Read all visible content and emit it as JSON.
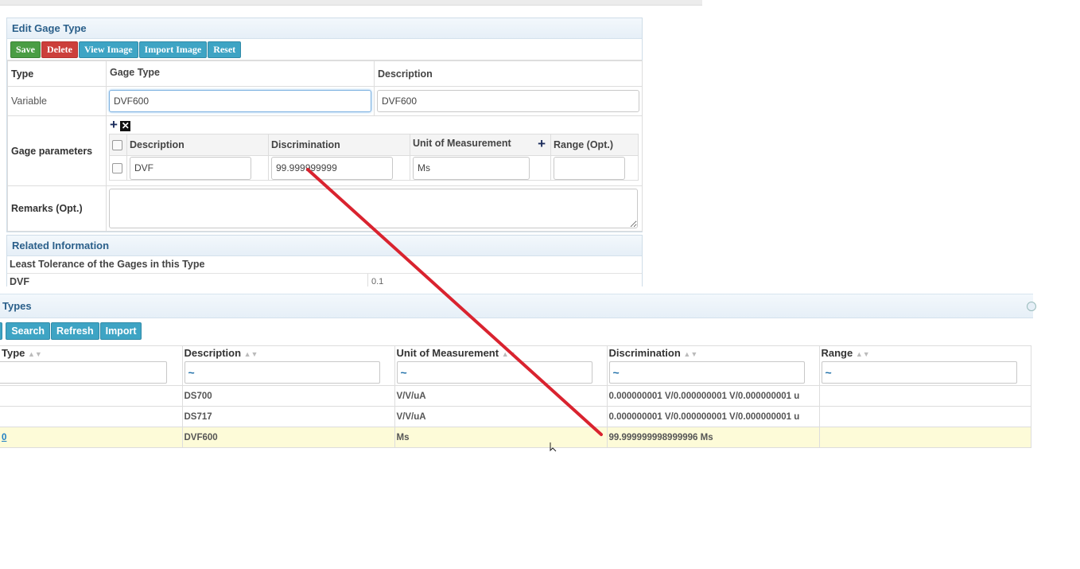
{
  "edit_panel": {
    "title": "Edit Gage Type",
    "buttons": {
      "save": "Save",
      "delete": "Delete",
      "view_image": "View Image",
      "import_image": "Import Image",
      "reset": "Reset"
    },
    "columns": {
      "type": "Type",
      "gage_type": "Gage Type",
      "description": "Description"
    },
    "type_value": "Variable",
    "gage_type_value": "DVF600",
    "description_value": "DVF600",
    "gage_parameters_label": "Gage parameters",
    "params_headers": {
      "description": "Description",
      "discrimination": "Discrimination",
      "unit": "Unit of Measurement",
      "range": "Range (Opt.)"
    },
    "params_row": {
      "description": "DVF",
      "discrimination": "99.999999999",
      "unit": "Ms",
      "range": ""
    },
    "remarks_label": "Remarks (Opt.)"
  },
  "related": {
    "title": "Related Information",
    "subtitle": "Least Tolerance of the Gages in this Type",
    "rows": [
      {
        "name": "DVF",
        "value": "0.1"
      }
    ]
  },
  "grid": {
    "title": "Types",
    "buttons": {
      "search": "Search",
      "refresh": "Refresh",
      "import": "Import"
    },
    "headers": {
      "type": "Type",
      "description": "Description",
      "unit": "Unit of Measurement",
      "discrimination": "Discrimination",
      "range": "Range"
    },
    "filter_placeholder": "~",
    "rows": [
      {
        "type": "",
        "description": "DS700",
        "unit": "V/V/uA",
        "discrimination": "0.000000001 V/0.000000001 V/0.000000001 u",
        "range": ""
      },
      {
        "type": "",
        "description": "DS717",
        "unit": "V/V/uA",
        "discrimination": "0.000000001 V/0.000000001 V/0.000000001 u",
        "range": ""
      },
      {
        "type": "0",
        "description": "DVF600",
        "unit": "Ms",
        "discrimination": "99.999999998999996 Ms",
        "range": ""
      }
    ]
  },
  "colors": {
    "annotation_line": "#d9232f",
    "selected_row": "#fdfbd8",
    "header_text": "#2a5f8a"
  }
}
